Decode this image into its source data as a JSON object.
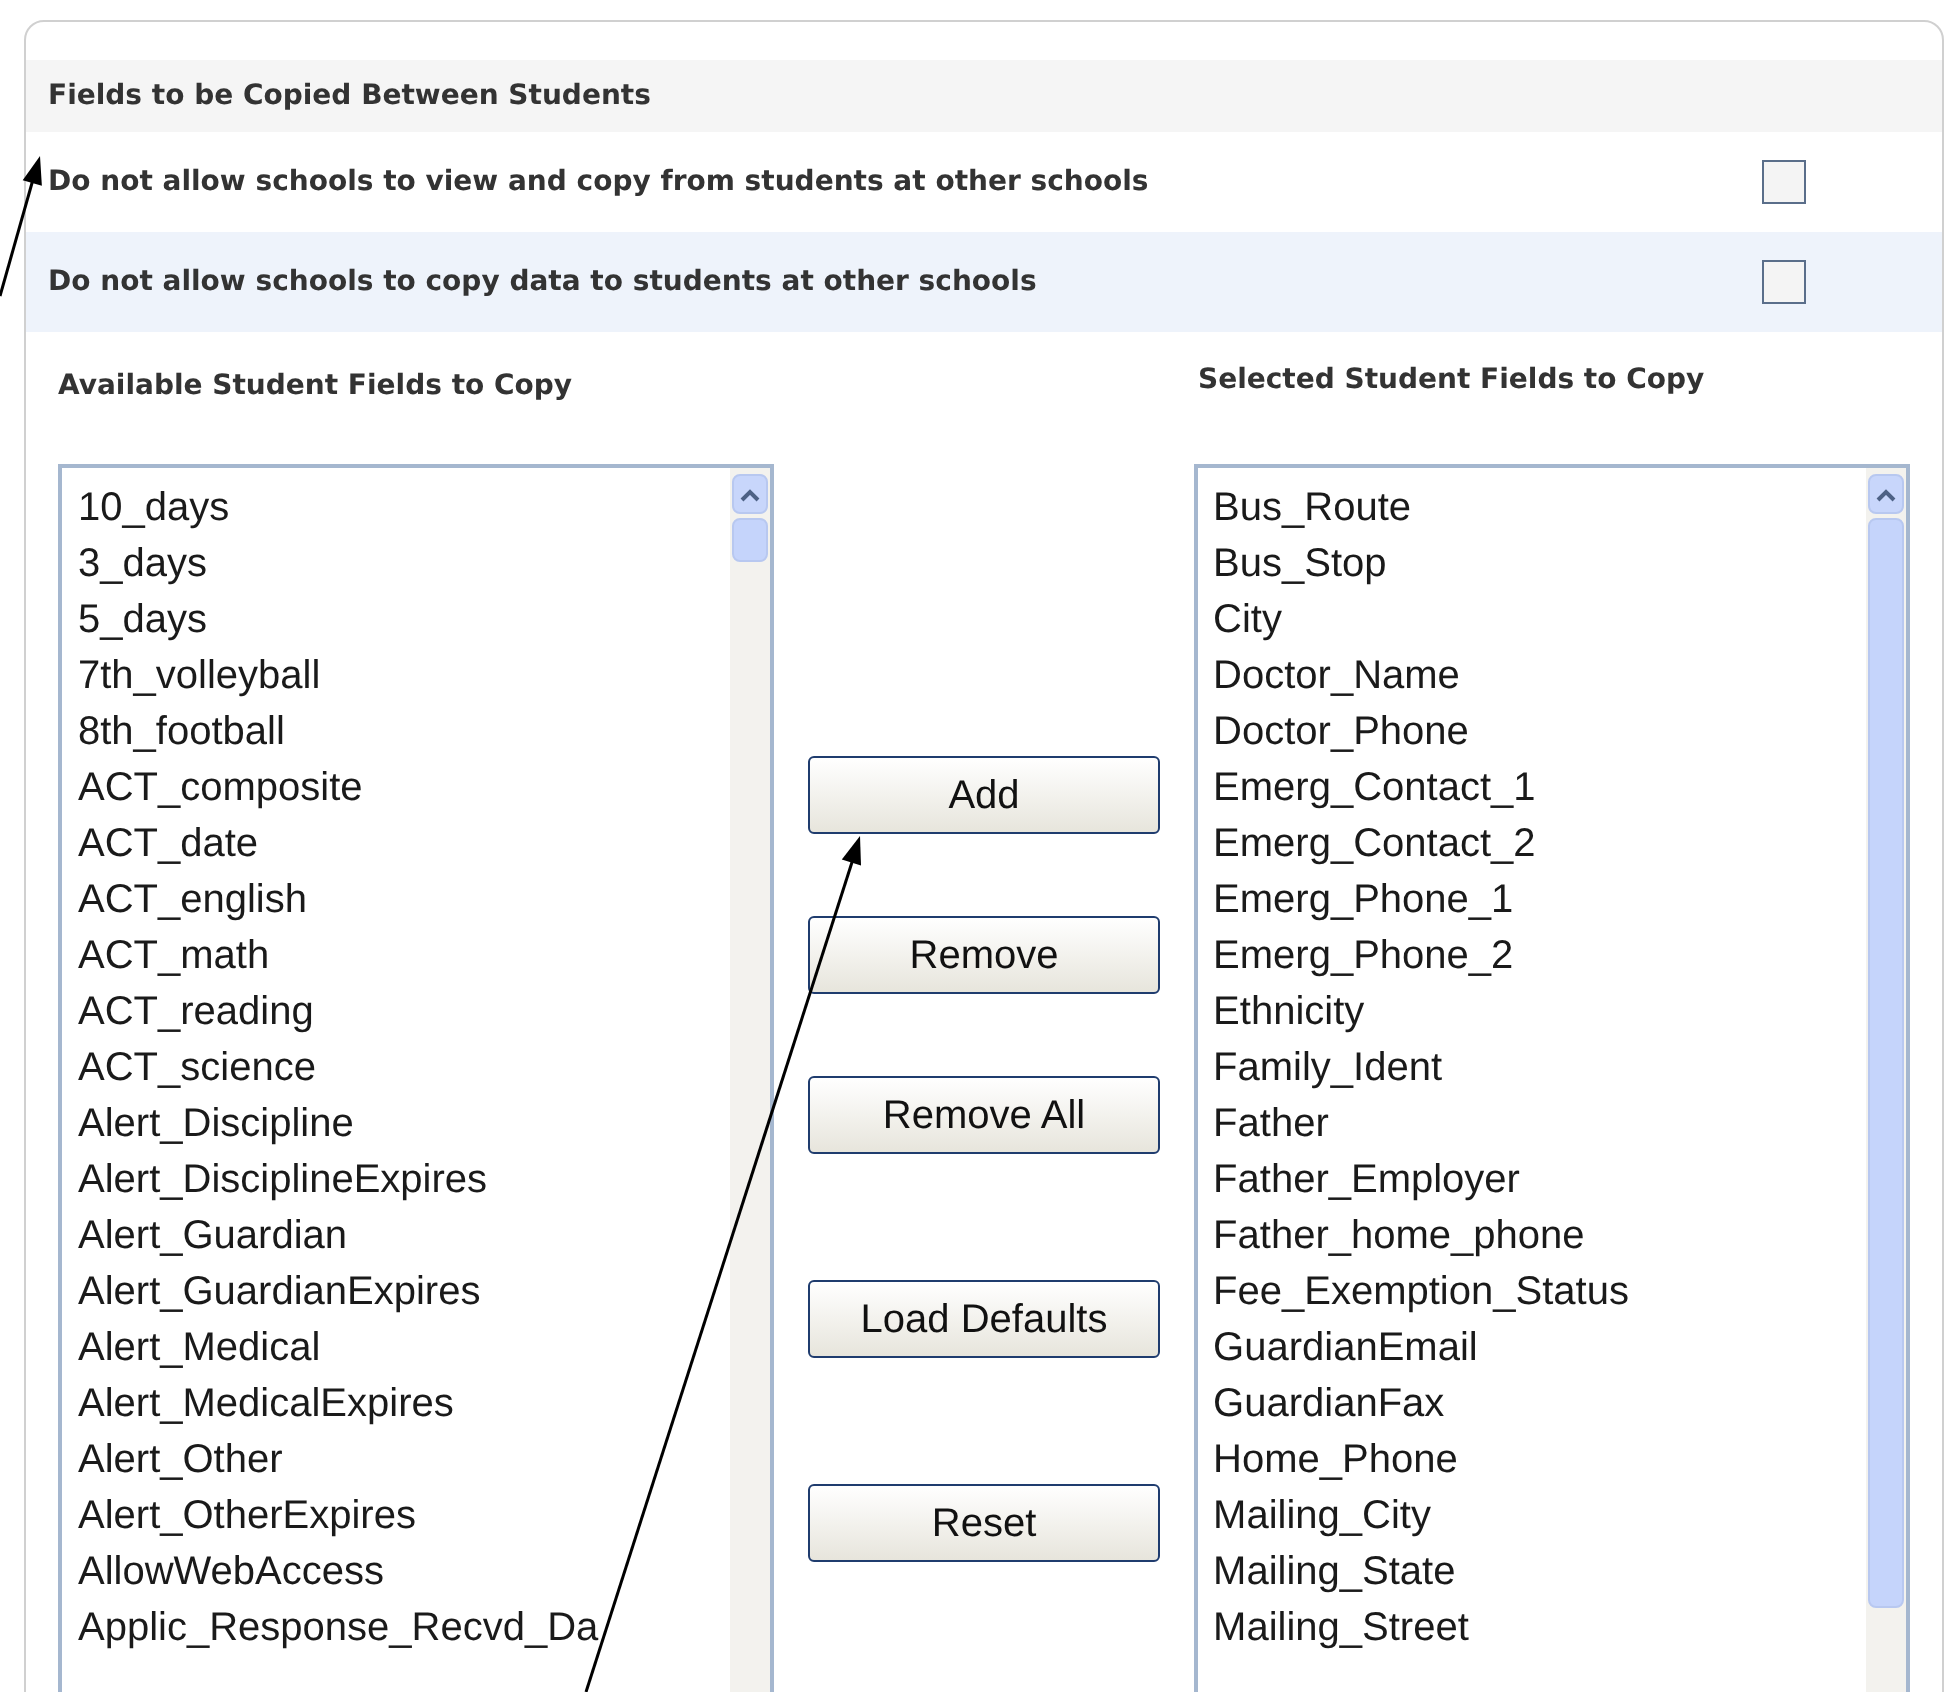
{
  "section": {
    "title": "Fields to be Copied Between Students"
  },
  "options": [
    {
      "label": "Do not allow schools to view and copy from students at other schools",
      "checked": false
    },
    {
      "label": "Do not allow schools to copy data to students at other schools",
      "checked": false
    }
  ],
  "available": {
    "heading": "Available Student Fields to Copy",
    "items": [
      "10_days",
      "3_days",
      "5_days",
      "7th_volleyball",
      "8th_football",
      "ACT_composite",
      "ACT_date",
      "ACT_english",
      "ACT_math",
      "ACT_reading",
      "ACT_science",
      "Alert_Discipline",
      "Alert_DisciplineExpires",
      "Alert_Guardian",
      "Alert_GuardianExpires",
      "Alert_Medical",
      "Alert_MedicalExpires",
      "Alert_Other",
      "Alert_OtherExpires",
      "AllowWebAccess",
      "Applic_Response_Recvd_Da"
    ]
  },
  "selected_fields": {
    "heading": "Selected Student Fields to Copy",
    "items": [
      "Bus_Route",
      "Bus_Stop",
      "City",
      "Doctor_Name",
      "Doctor_Phone",
      "Emerg_Contact_1",
      "Emerg_Contact_2",
      "Emerg_Phone_1",
      "Emerg_Phone_2",
      "Ethnicity",
      "Family_Ident",
      "Father",
      "Father_Employer",
      "Father_home_phone",
      "Fee_Exemption_Status",
      "GuardianEmail",
      "GuardianFax",
      "Home_Phone",
      "Mailing_City",
      "Mailing_State",
      "Mailing_Street"
    ]
  },
  "buttons": [
    "Add",
    "Remove",
    "Remove All",
    "Load Defaults",
    "Reset"
  ]
}
